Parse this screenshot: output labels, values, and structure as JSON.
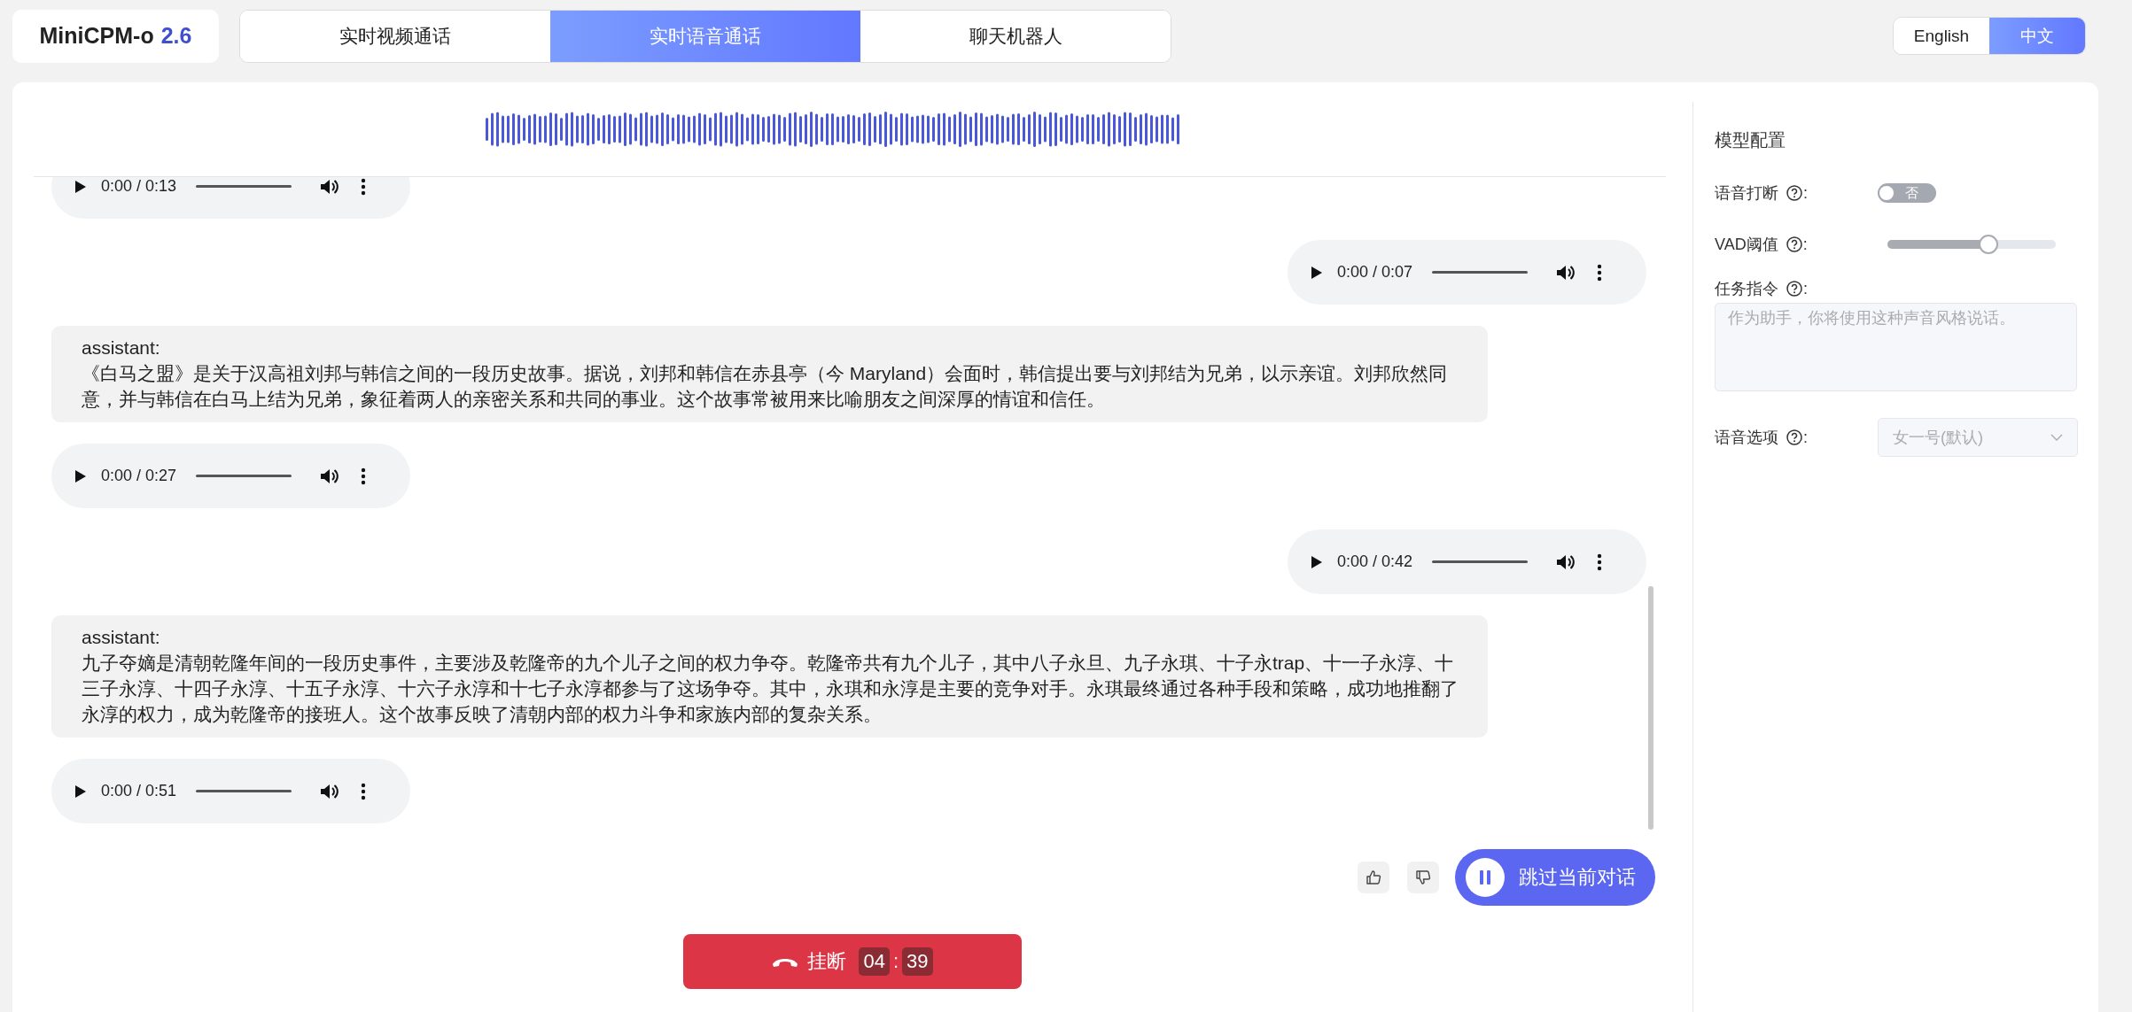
{
  "logo": {
    "name": "MiniCPM-o",
    "version": "2.6"
  },
  "mode_tabs": [
    {
      "label": "实时视频通话",
      "selected": false
    },
    {
      "label": "实时语音通话",
      "selected": true
    },
    {
      "label": "聊天机器人",
      "selected": false
    }
  ],
  "language_switch": [
    {
      "label": "English",
      "selected": false
    },
    {
      "label": "中文",
      "selected": true
    }
  ],
  "chat": {
    "messages": [
      {
        "kind": "audio",
        "outgoing": false,
        "time": "0:00 / 0:13"
      },
      {
        "kind": "audio",
        "outgoing": true,
        "time": "0:00 / 0:07"
      },
      {
        "kind": "text",
        "outgoing": false,
        "speaker": "assistant:",
        "text": "《白马之盟》是关于汉高祖刘邦与韩信之间的一段历史故事。据说，刘邦和韩信在赤县亭（今 Maryland）会面时，韩信提出要与刘邦结为兄弟，以示亲谊。刘邦欣然同意，并与韩信在白马上结为兄弟，象征着两人的亲密关系和共同的事业。这个故事常被用来比喻朋友之间深厚的情谊和信任。"
      },
      {
        "kind": "audio",
        "outgoing": false,
        "time": "0:00 / 0:27"
      },
      {
        "kind": "audio",
        "outgoing": true,
        "time": "0:00 / 0:42"
      },
      {
        "kind": "text",
        "outgoing": false,
        "speaker": "assistant:",
        "text": "九子夺嫡是清朝乾隆年间的一段历史事件，主要涉及乾隆帝的九个儿子之间的权力争夺。乾隆帝共有九个儿子，其中八子永旦、九子永琪、十子永trap、十一子永淳、十三子永淳、十四子永淳、十五子永淳、十六子永淳和十七子永淳都参与了这场争夺。其中，永琪和永淳是主要的竞争对手。永琪最终通过各种手段和策略，成功地推翻了永淳的权力，成为乾隆帝的接班人。这个故事反映了清朝内部的权力斗争和家族内部的复杂关系。"
      },
      {
        "kind": "audio",
        "outgoing": false,
        "time": "0:00 / 0:51"
      }
    ]
  },
  "skip_button": {
    "label": "跳过当前对话"
  },
  "hangup_button": {
    "label": "挂断",
    "minutes": "04",
    "separator": ":",
    "seconds": "39"
  },
  "config": {
    "title": "模型配置",
    "interrupt": {
      "label": "语音打断",
      "colon": ":",
      "state_label": "否",
      "on": false,
      "disabled": true
    },
    "vad": {
      "label": "VAD阈值",
      "colon": ":",
      "level": 0.6
    },
    "task": {
      "label": "任务指令",
      "colon": ":",
      "placeholder": "作为助手，你将使用这种声音风格说话。"
    },
    "voice": {
      "label": "语音选项",
      "colon": ":",
      "value": "女一号(默认)",
      "disabled": true
    }
  }
}
